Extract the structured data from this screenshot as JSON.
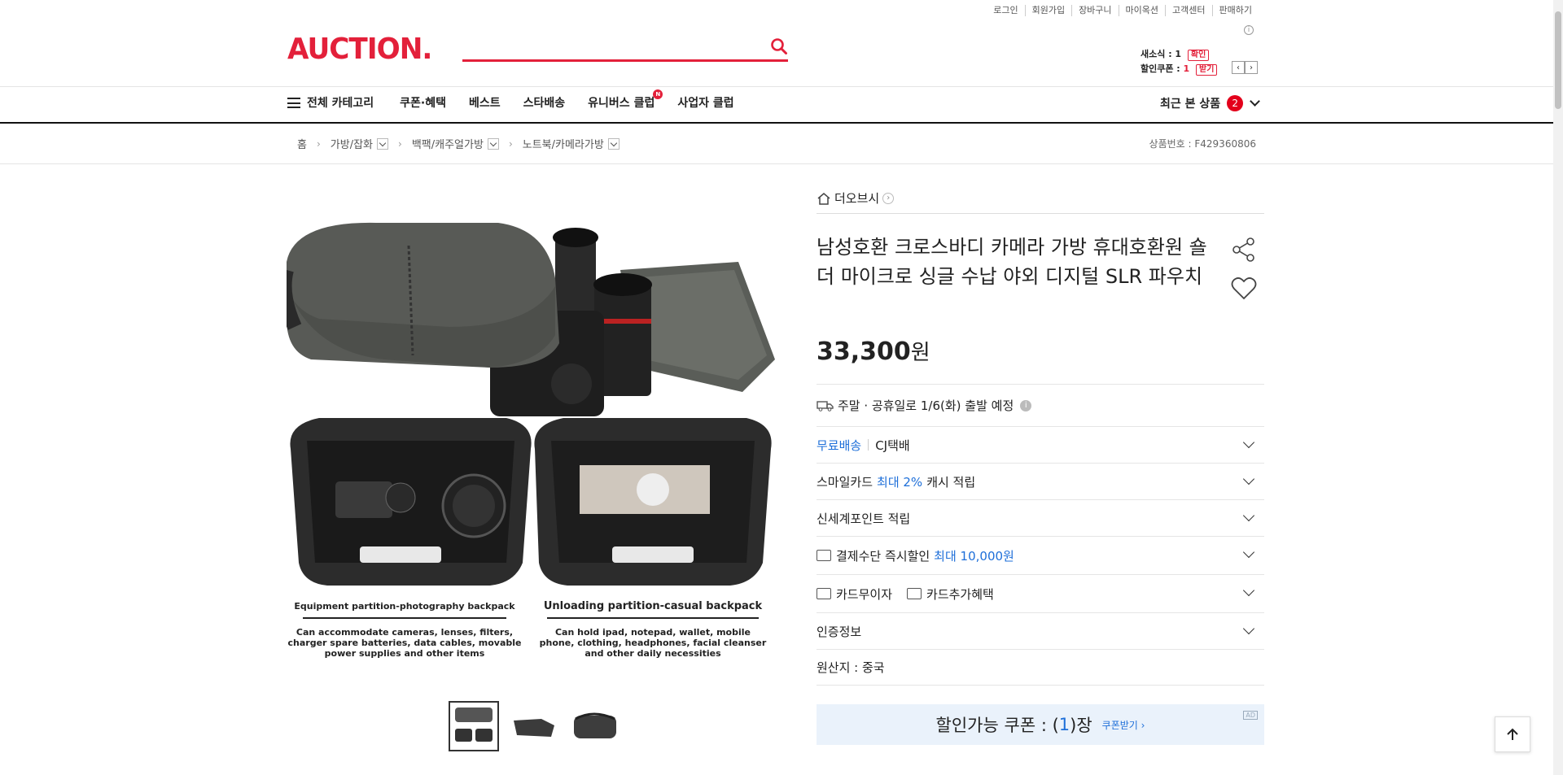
{
  "util_links": [
    "로그인",
    "회원가입",
    "장바구니",
    "마이옥션",
    "고객센터",
    "판매하기"
  ],
  "logo": "AUCTION.",
  "search": {
    "placeholder": ""
  },
  "mini": {
    "news_label": "새소식 : 1",
    "news_btn": "확인",
    "coupon_label": "할인쿠폰 : ",
    "coupon_count": "1",
    "coupon_btn": "받기"
  },
  "nav": {
    "all_categories": "전체 카테고리",
    "items": [
      "쿠폰·혜택",
      "베스트",
      "스타배송",
      "유니버스 클럽",
      "사업자 클럽"
    ],
    "universe_badge": "N",
    "recent_label": "최근 본 상품",
    "recent_count": "2"
  },
  "breadcrumb": {
    "home": "홈",
    "levels": [
      "가방/잡화",
      "백팩/캐주얼가방",
      "노트북/카메라가방"
    ],
    "product_no": "상품번호 : F429360806"
  },
  "product": {
    "store": "더오브시",
    "title": "남성호환 크로스바디 카메라 가방 휴대호환원 숄더 마이크로 싱글 수납 야외 디지털 SLR 파우치",
    "price": "33,300",
    "price_unit": "원",
    "image_captions": {
      "left_title": "Equipment partition-photography backpack",
      "left_desc": "Can accommodate cameras, lenses, filters, charger spare batteries, data cables, movable power supplies and other items",
      "right_title": "Unloading partition-casual backpack",
      "right_desc": "Can hold ipad, notepad, wallet, mobile phone, clothing, headphones, facial cleanser and other daily necessities"
    }
  },
  "rows": {
    "ship": "주말 · 공휴일로 1/6(화) 출발 예정",
    "free_ship": "무료배송",
    "courier": "CJ택배",
    "smile_pre": "스마일카드 ",
    "smile_hl": "최대 2%",
    "smile_post": " 캐시 적립",
    "shinsegae": "신세계포인트 적립",
    "pay_pre": "결제수단 즉시할인 ",
    "pay_hl": "최대 10,000원",
    "interest_free": "카드무이자",
    "card_benefit": "카드추가혜택",
    "cert": "인증정보",
    "origin": "원산지 : 중국"
  },
  "coupon": {
    "label": "할인가능 쿠폰 : (",
    "count": "1",
    "unit": ")장",
    "get": "쿠폰받기 ›",
    "ad": "AD"
  },
  "colors": {
    "brand": "#e3203a",
    "accent_blue": "#1e6fd9"
  }
}
